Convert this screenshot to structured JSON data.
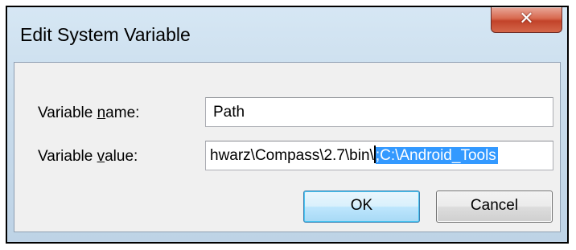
{
  "window": {
    "title": "Edit System Variable",
    "close_icon": "close-icon",
    "close_glyph": "✕"
  },
  "fields": {
    "name": {
      "label": "Variable name:",
      "value": "Path"
    },
    "value": {
      "label": "Variable value:",
      "value_before_cursor": "hwarz\\Compass\\2.7\\bin\\",
      "selected_text": ";C:\\Android_Tools"
    }
  },
  "buttons": {
    "ok_label": "OK",
    "cancel_label": "Cancel"
  },
  "colors": {
    "selection": "#3399ff",
    "close_button": "#c7432a",
    "frame_tint": "#c9dcec"
  }
}
